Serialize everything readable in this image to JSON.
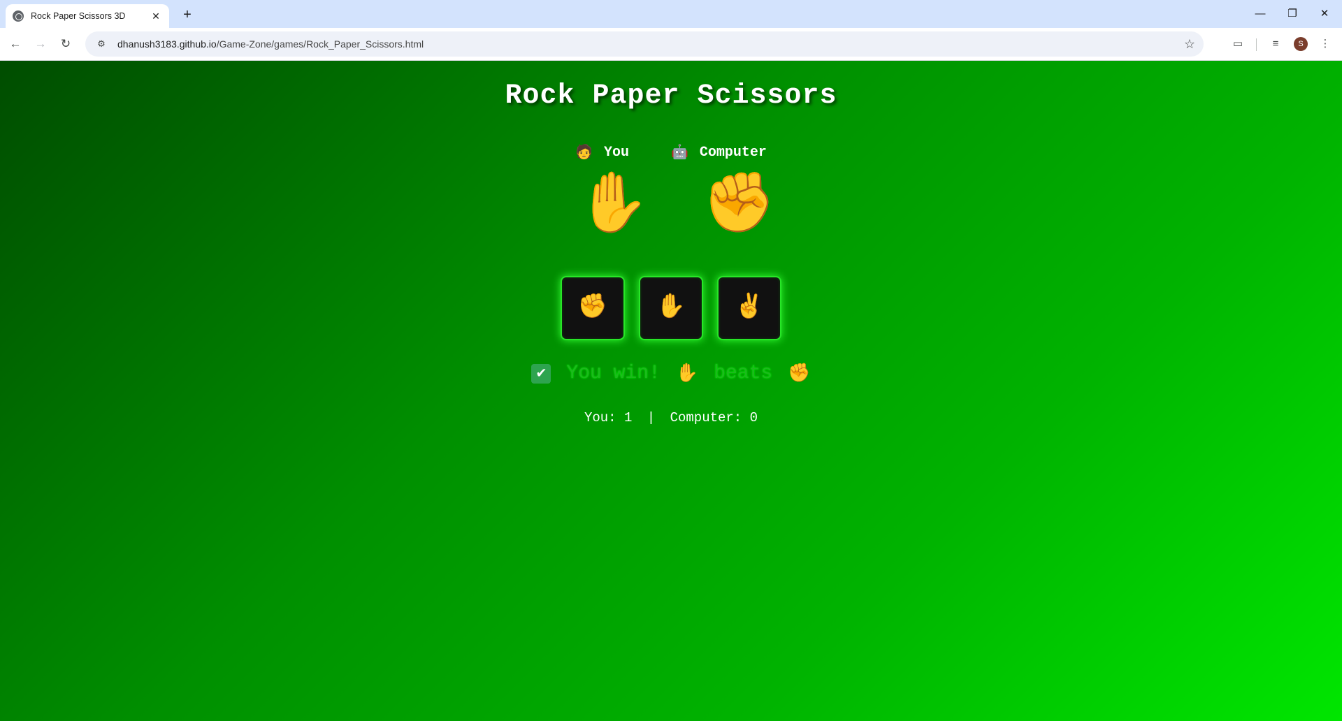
{
  "browser": {
    "tab_title": "Rock Paper Scissors 3D",
    "tab_close": "✕",
    "new_tab": "+",
    "url_host": "dhanush3183.github.io",
    "url_path": "/Game-Zone/games/Rock_Paper_Scissors.html",
    "profile_initial": "S",
    "window_controls": {
      "minimize": "—",
      "restore": "❐",
      "close": "✕"
    }
  },
  "game": {
    "title": "Rock Paper Scissors",
    "player_label": "You",
    "player_emoji": "🧑",
    "computer_label": "Computer",
    "computer_emoji": "🤖",
    "player_hand": "✋",
    "computer_hand": "✊",
    "choices": [
      {
        "id": "rock",
        "emoji": "✊"
      },
      {
        "id": "paper",
        "emoji": "✋"
      },
      {
        "id": "scissors",
        "emoji": "✌️"
      }
    ],
    "result": {
      "check": "✔",
      "text": "You win!",
      "winner_emoji": "✋",
      "beats": "beats",
      "loser_emoji": "✊"
    },
    "score": {
      "you_label": "You:",
      "you": "1",
      "separator": "|",
      "computer_label": "Computer:",
      "computer": "0"
    }
  }
}
